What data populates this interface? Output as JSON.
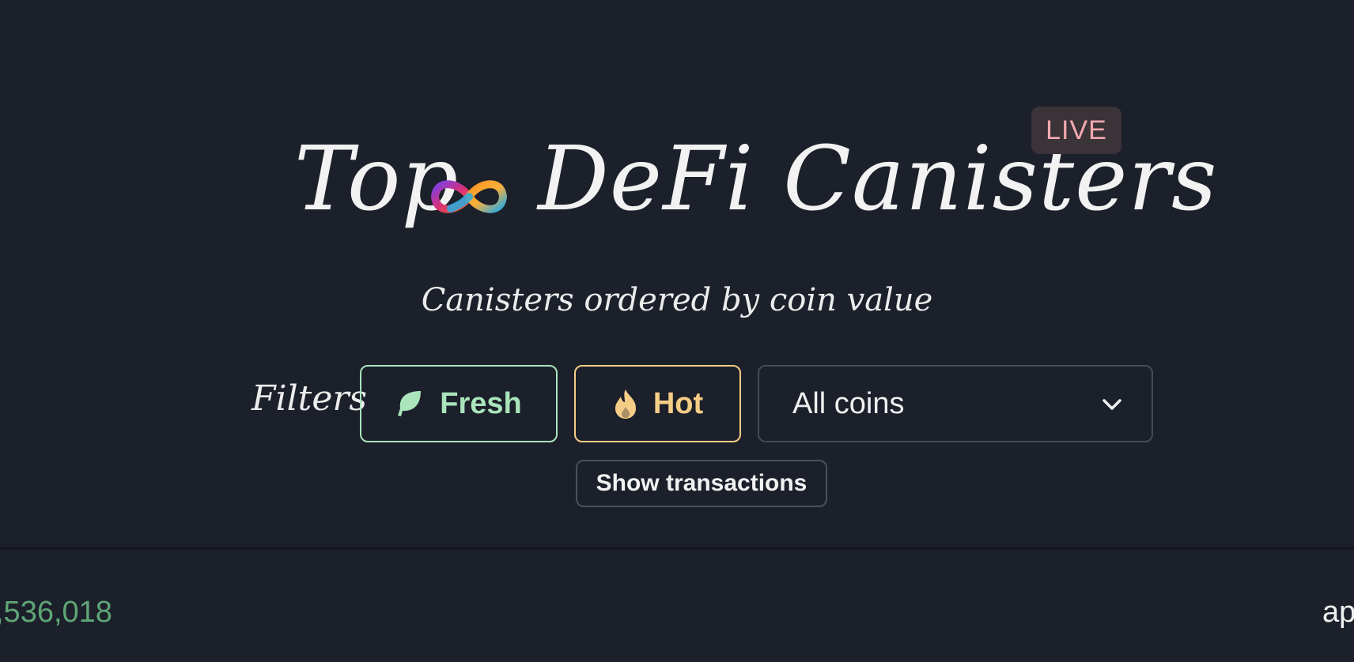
{
  "header": {
    "title_left": "Top",
    "title_right": "DeFi Canisters",
    "live_badge": "LIVE",
    "subtitle": "Canisters ordered by coin value",
    "logo_icon": "infinity-logo-icon"
  },
  "filters": {
    "label": "Filters",
    "fresh": {
      "label": "Fresh",
      "icon": "leaf-icon",
      "color": "#a9e4bb"
    },
    "hot": {
      "label": "Hot",
      "icon": "flame-icon",
      "color": "#f6cd86"
    },
    "coin_select": {
      "value": "All coins",
      "icon": "chevron-down-icon"
    },
    "show_transactions": "Show transactions"
  },
  "table": {
    "first_row_value": ",536,018",
    "first_row_right": "ap"
  },
  "colors": {
    "background": "#1c202b",
    "live_text": "#f2a9b0",
    "value_green": "#5fa676"
  }
}
